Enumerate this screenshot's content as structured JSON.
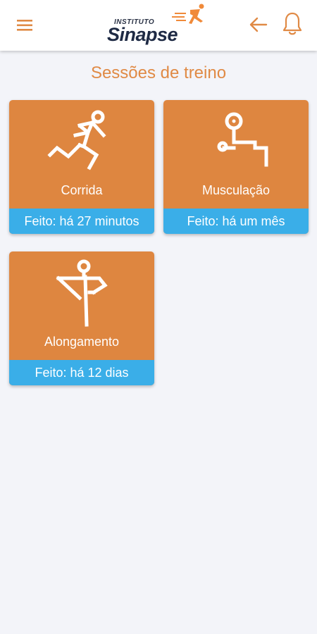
{
  "header": {
    "logo_top": "INSTITUTO",
    "logo_main": "Sinapse"
  },
  "page": {
    "title": "Sessões de treino"
  },
  "sessions": [
    {
      "label": "Corrida",
      "status": "Feito: há 27 minutos",
      "icon": "running-icon"
    },
    {
      "label": "Musculação",
      "status": "Feito: há um mês",
      "icon": "weightlifting-icon"
    },
    {
      "label": "Alongamento",
      "status": "Feito: há 12 dias",
      "icon": "stretching-icon"
    }
  ],
  "colors": {
    "accent": "#de8640",
    "status_bar": "#3aaee8",
    "title": "#e08a45",
    "background": "#f3f4f9"
  }
}
